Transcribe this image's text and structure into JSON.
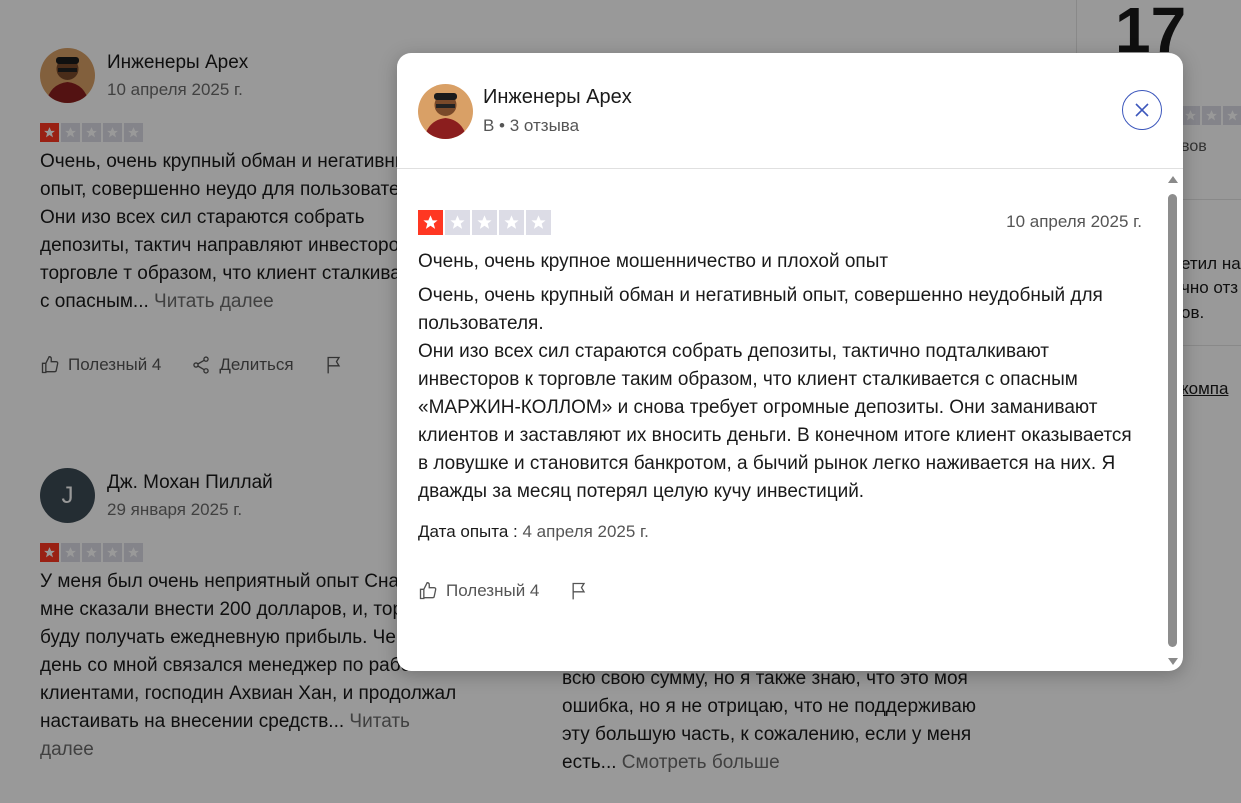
{
  "background": {
    "reviews": [
      {
        "name": "Инженеры Apex",
        "date": "10 апреля 2025 г.",
        "rating": 1,
        "text": "Очень, очень крупный обман и негативный опыт, совершенно неудо для пользователя. Они изо всех сил стараются собрать депозиты, тактич направляют инвесторов к торговле т образом, что клиент сталкивается с опасным...",
        "read_more": "Читать далее",
        "helpful_label": "Полезный 4",
        "share_label": "Делиться"
      },
      {
        "name": "Дж. Мохан Пиллай",
        "initial": "J",
        "date": "29 января 2025 г.",
        "rating": 1,
        "text": "У меня был очень неприятный опыт Сначала мне сказали внести 200 долларов, и, торгуя, я буду получать ежедневную прибыль. Через день со мной связался менеджер по работе с клиентами, господин Ахвиан Хан, и продолжал настаивать на внесении средств...",
        "read_more": "Читать далее"
      },
      {
        "text": "всю свою сумму, но я также знаю, что это моя ошибка, но я не отрицаю, что не поддерживаю эту большую часть, к сожалению, если у меня есть...",
        "read_more": "Смотреть больше"
      }
    ],
    "summary": {
      "count": "17",
      "reviews_text": "вов",
      "reply_line1": "етил на",
      "reply_line2": "чно отз",
      "reply_line3": "ов.",
      "company_link": "компа"
    }
  },
  "modal": {
    "name": "Инженеры Apex",
    "meta": "В • 3 отзыва",
    "rating": 1,
    "date": "10 апреля 2025 г.",
    "title": "Очень, очень крупное мошенничество и плохой опыт",
    "paragraph1": "Очень, очень крупный обман и негативный опыт, совершенно неудобный для пользователя.",
    "paragraph2": "Они изо всех сил стараются собрать депозиты, тактично подталкивают инвесторов к торговле таким образом, что клиент сталкивается с опасным «МАРЖИН-КОЛЛОМ» и снова требует огромные депозиты. Они заманивают клиентов и заставляют их вносить деньги. В конечном итоге клиент оказывается в ловушке и становится банкротом, а бычий рынок легко наживается на них. Я дважды за месяц потерял целую кучу инвестиций.",
    "experience_label": "Дата опыта :",
    "experience_date": "4 апреля 2025 г.",
    "helpful_label": "Полезный 4"
  },
  "colors": {
    "star_on": "#ff3722",
    "star_off": "#dcdce6",
    "close_accent": "#3c57bc",
    "overlay": "rgba(0,0,0,0.40)"
  }
}
